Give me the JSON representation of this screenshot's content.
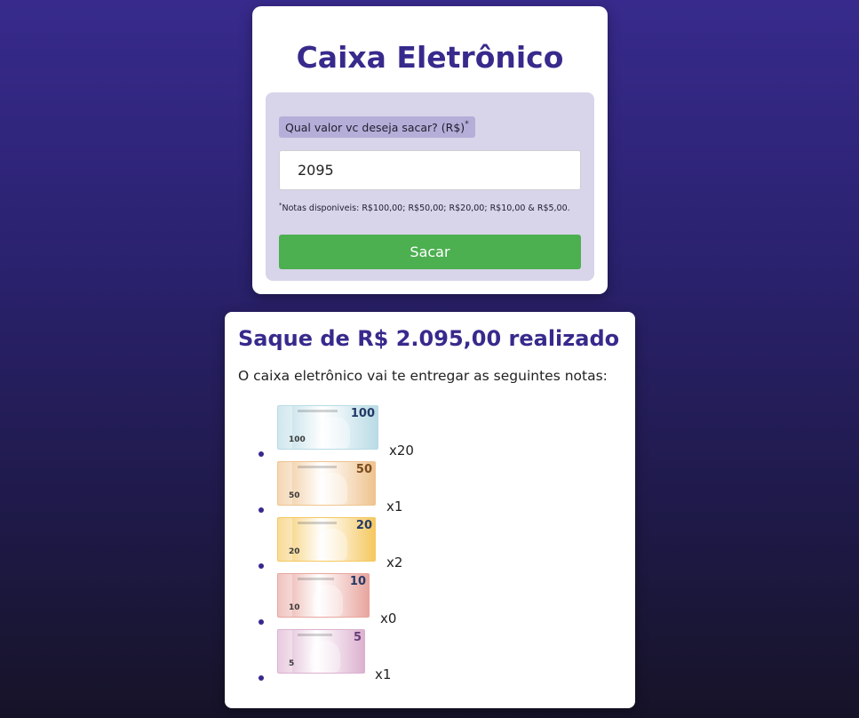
{
  "header": {
    "title": "Caixa Eletrônico"
  },
  "form": {
    "question_label": "Qual valor vc deseja sacar? (R$)",
    "question_mark": "*",
    "amount_value": "2095",
    "notes_info_mark": "*",
    "notes_info": "Notas disponiveis: R$100,00; R$50,00; R$20,00; R$10,00 & R$5,00.",
    "submit_label": "Sacar"
  },
  "result": {
    "title": "Saque de R$ 2.095,00 realizado",
    "description": "O caixa eletrônico vai te entregar as seguintes notas:",
    "notes": [
      {
        "denomination": "100",
        "count_label": "x20",
        "color": "#b9dbe6",
        "accent": "#233a66"
      },
      {
        "denomination": "50",
        "count_label": "x1",
        "color": "#efc38f",
        "accent": "#7a4a1c"
      },
      {
        "denomination": "20",
        "count_label": "x2",
        "color": "#f5c860",
        "accent": "#233a66"
      },
      {
        "denomination": "10",
        "count_label": "x0",
        "color": "#e8a59e",
        "accent": "#233a66"
      },
      {
        "denomination": "5",
        "count_label": "x1",
        "color": "#dcb1cf",
        "accent": "#6b3d7a"
      }
    ]
  }
}
